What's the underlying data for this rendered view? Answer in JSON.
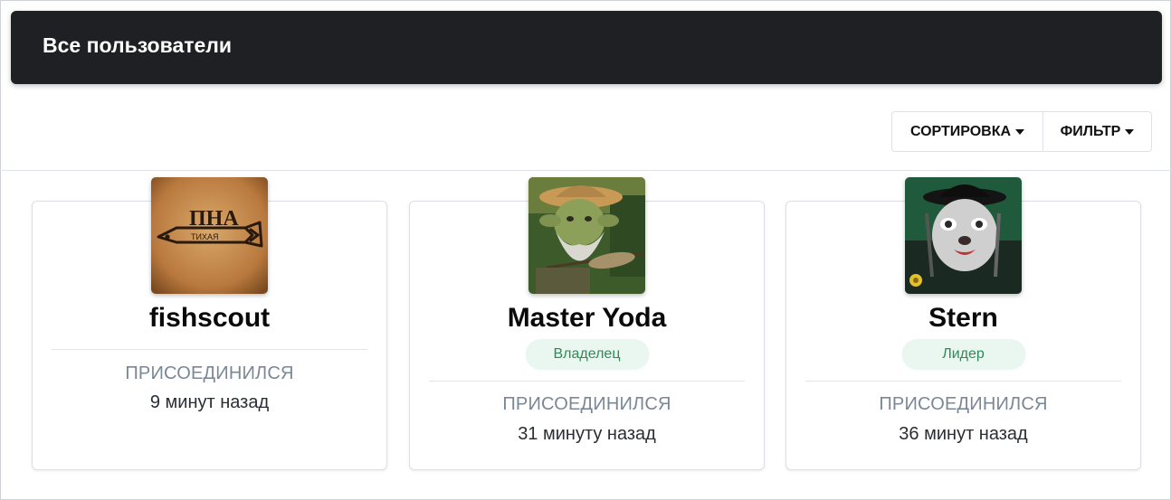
{
  "header": {
    "title": "Все пользователи"
  },
  "toolbar": {
    "sort_label": "СОРТИРОВКА",
    "filter_label": "ФИЛЬТР"
  },
  "users": [
    {
      "name": "fishscout",
      "role": "",
      "joined_label": "ПРИСОЕДИНИЛСЯ",
      "joined_value": "9 минут назад",
      "avatar_text": "ПНА",
      "avatar_subtext": "ТИХАЯ"
    },
    {
      "name": "Master Yoda",
      "role": "Владелец",
      "joined_label": "ПРИСОЕДИНИЛСЯ",
      "joined_value": "31 минуту назад"
    },
    {
      "name": "Stern",
      "role": "Лидер",
      "joined_label": "ПРИСОЕДИНИЛСЯ",
      "joined_value": "36 минут назад"
    }
  ],
  "colors": {
    "header_bg": "#1f2023",
    "badge_bg": "#eaf6f0",
    "badge_text": "#2e8b57",
    "label_gray": "#7a8797"
  }
}
